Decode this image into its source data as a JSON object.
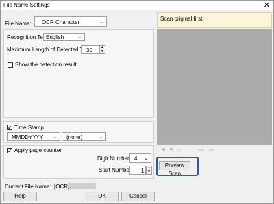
{
  "window": {
    "title": "File Name Settings",
    "close_icon": "close-icon"
  },
  "file_name": {
    "label": "File Name:",
    "value": "OCR Character"
  },
  "recognition": {
    "label": "Recognition Text:",
    "value": "English"
  },
  "max_length": {
    "label": "Maximum Length of Detected Text:",
    "value": "30"
  },
  "show_detection": {
    "label": "Show the detection result",
    "checked": false
  },
  "time_stamp": {
    "label": "Time Stamp",
    "checked": true,
    "format": "MMDDYYYY",
    "sep": "(none)"
  },
  "page_counter": {
    "label": "Apply page counter",
    "checked": true,
    "digit_label": "Digit Number:",
    "digit_value": "4",
    "start_label": "Start Number:",
    "start_value": "1"
  },
  "current_file_name": {
    "label": "Current File Name:",
    "value": "[OCR]"
  },
  "buttons": {
    "help": "Help",
    "ok": "OK",
    "cancel": "Cancel",
    "preview": "Preview Scan"
  },
  "preview": {
    "message": "Scan original first."
  },
  "colors": {
    "highlight": "#2a5aa0",
    "preview_bg": "#ababab",
    "message_bg": "#fbf6d9"
  }
}
